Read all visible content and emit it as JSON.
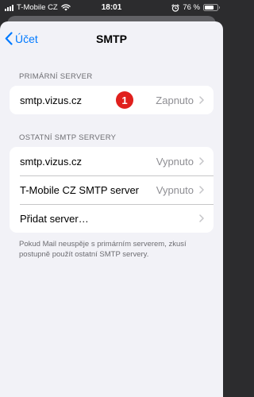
{
  "status_bar": {
    "carrier": "T-Mobile CZ",
    "time": "18:01",
    "battery": "76 %",
    "battery_level": 0.76
  },
  "nav": {
    "back_label": "Účet",
    "title": "SMTP"
  },
  "primary": {
    "header": "PRIMÁRNÍ SERVER",
    "badge": "1",
    "row": {
      "label": "smtp.vizus.cz",
      "value": "Zapnuto"
    }
  },
  "other": {
    "header": "OSTATNÍ SMTP SERVERY",
    "rows": [
      {
        "label": "smtp.vizus.cz",
        "value": "Vypnuto"
      },
      {
        "label": "T-Mobile CZ SMTP server",
        "value": "Vypnuto"
      },
      {
        "label": "Přidat server…",
        "value": ""
      }
    ]
  },
  "footer": "Pokud Mail neuspěje s primárním serverem, zkusí postupně použít ostatní SMTP servery.",
  "colors": {
    "accent": "#007aff",
    "badge": "#e0201d",
    "background": "#f2f2f7"
  }
}
